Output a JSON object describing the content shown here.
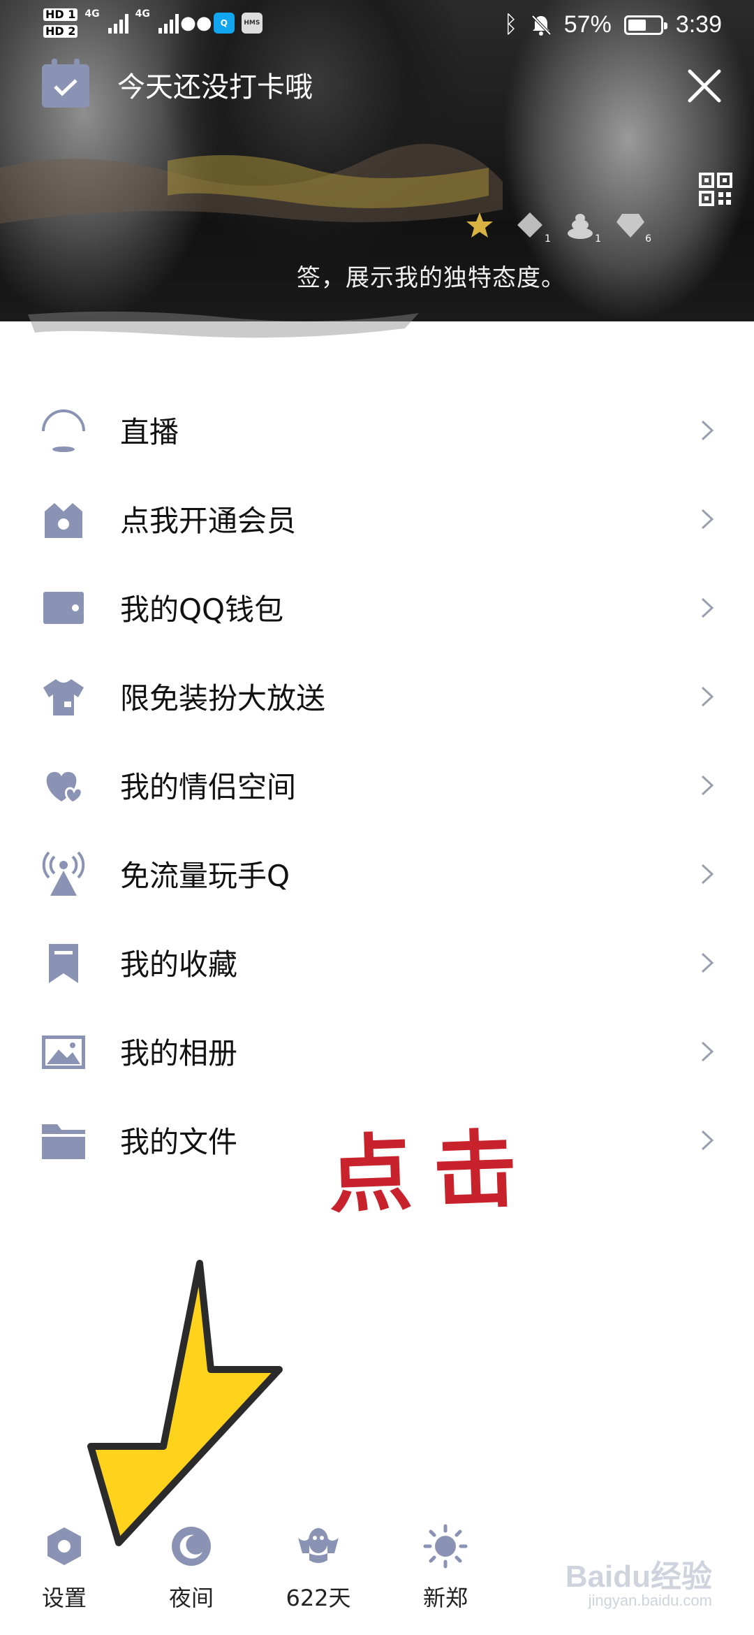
{
  "status_bar": {
    "hd1": "HD 1",
    "hd2": "HD 2",
    "net1": "4G",
    "net2": "4G",
    "hms": "HMS",
    "battery_percent": "57%",
    "battery_level": 0.57,
    "time": "3:39"
  },
  "header": {
    "checkin_text": "今天还没打卡哦",
    "signature": "签，展示我的独特态度。",
    "badges": [
      {
        "icon": "star-badge-icon",
        "count": ""
      },
      {
        "icon": "level-badge-icon",
        "count": "1"
      },
      {
        "icon": "poop-badge-icon",
        "count": "1"
      },
      {
        "icon": "diamond-badge-icon",
        "count": "6"
      }
    ]
  },
  "menu": {
    "items": [
      {
        "label": "直播",
        "icon": "live-icon"
      },
      {
        "label": "点我开通会员",
        "icon": "vip-crown-icon"
      },
      {
        "label": "我的QQ钱包",
        "icon": "wallet-icon"
      },
      {
        "label": "限免装扮大放送",
        "icon": "tshirt-icon"
      },
      {
        "label": "我的情侣空间",
        "icon": "couple-hearts-icon"
      },
      {
        "label": "免流量玩手Q",
        "icon": "signal-tower-icon"
      },
      {
        "label": "我的收藏",
        "icon": "bookmark-icon"
      },
      {
        "label": "我的相册",
        "icon": "photo-album-icon"
      },
      {
        "label": "我的文件",
        "icon": "folder-icon"
      }
    ]
  },
  "annotation": {
    "text": "点击"
  },
  "bottom_bar": {
    "items": [
      {
        "label": "设置",
        "icon": "settings-hexagon-icon"
      },
      {
        "label": "夜间",
        "icon": "moon-icon"
      },
      {
        "label": "622天",
        "icon": "qq-penguin-icon"
      },
      {
        "label": "新郑",
        "icon": "sun-weather-icon"
      }
    ]
  },
  "watermark": {
    "brand": "Baidu经验",
    "url": "jingyan.baidu.com"
  },
  "colors": {
    "icon_gray": "#8a93b4",
    "annotation_red": "#c8232c",
    "arrow_yellow": "#ffd21c"
  }
}
